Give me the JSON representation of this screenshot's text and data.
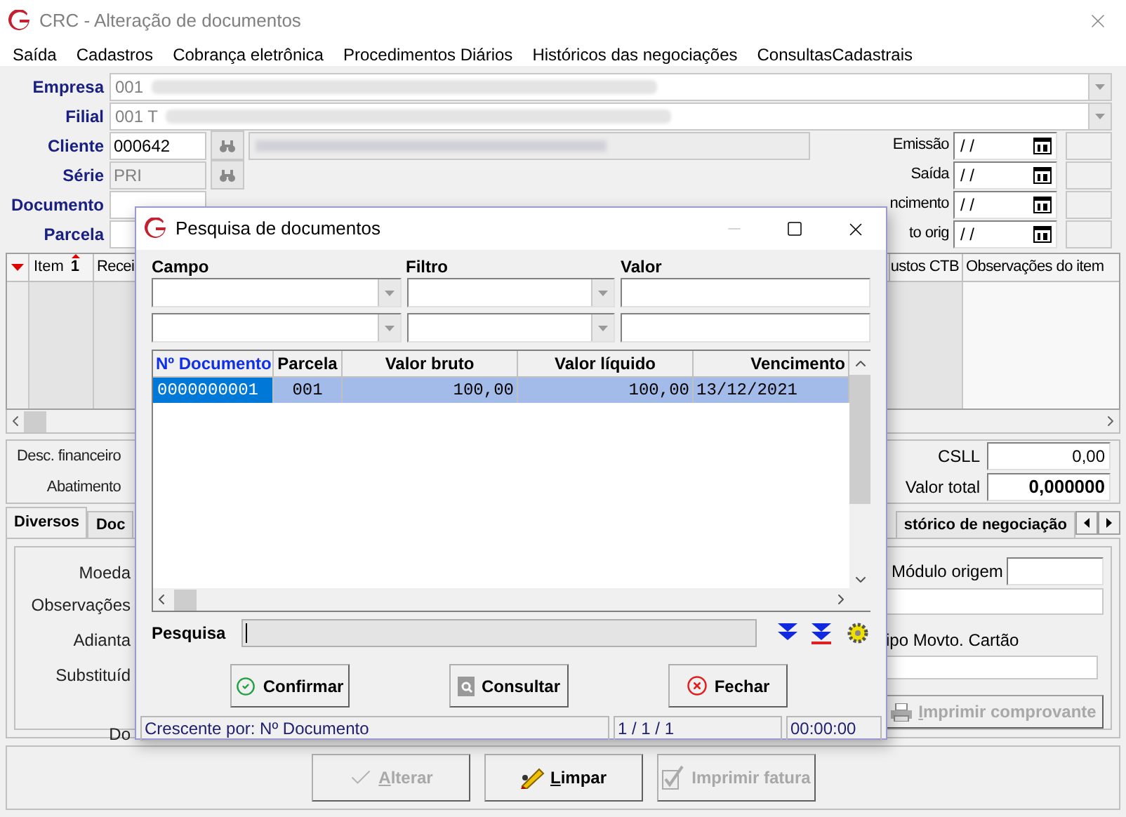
{
  "window": {
    "title": "CRC - Alteração de documentos"
  },
  "menu": [
    "Saída",
    "Cadastros",
    "Cobrança eletrônica",
    "Procedimentos Diários",
    "Históricos das negociações",
    "ConsultasCadastrais"
  ],
  "selectors": [
    {
      "label": "Empresa",
      "value": "001"
    },
    {
      "label": "Filial",
      "value": "001 T"
    }
  ],
  "codes": [
    {
      "label": "Cliente",
      "value": "000642",
      "disabled": false,
      "lookup": true
    },
    {
      "label": "Série",
      "value": "PRI",
      "disabled": true,
      "lookup": true
    },
    {
      "label": "Documento",
      "disabled": false,
      "lookup": false
    },
    {
      "label": "Parcela",
      "disabled": false,
      "lookup": false
    }
  ],
  "dates": [
    {
      "label": "Emissão",
      "value": "/ /"
    },
    {
      "label": "Saída",
      "value": "/ /"
    },
    {
      "label": "ncimento",
      "value": "/ /"
    },
    {
      "label": "to orig",
      "value": "/ /"
    }
  ],
  "items_grid": {
    "columns": [
      "Item",
      "Recei",
      "ustos CTB",
      "Observações do item"
    ],
    "sort_indicator": "1"
  },
  "totals_left": [
    "Desc. financeiro",
    "Abatimento"
  ],
  "totals_right": [
    {
      "label": "CSLL",
      "value": "0,00",
      "bold": false
    },
    {
      "label": "Valor total",
      "value": "0,000000",
      "bold": true
    }
  ],
  "tabs": [
    {
      "label": "Diversos",
      "selected": true
    },
    {
      "label": "Doc",
      "selected": false
    },
    {
      "label": "stórico de negociação",
      "selected": false
    }
  ],
  "tab_panel": {
    "left_labels": [
      "Moeda",
      "Observações",
      "Adianta",
      "Substituíd",
      "Do"
    ],
    "module_label": "Módulo origem",
    "card_type_label": "ipo Movto. Cartão",
    "print_button": {
      "label": "Imprimir comprovante",
      "disabled": true
    }
  },
  "bottom_buttons": [
    {
      "label": "Alterar",
      "disabled": true
    },
    {
      "label": "Limpar",
      "disabled": false
    },
    {
      "label": "Imprimir fatura",
      "disabled": true
    }
  ],
  "dialog": {
    "title": "Pesquisa de documentos",
    "filter_headers": [
      "Campo",
      "Filtro",
      "Valor"
    ],
    "table": {
      "columns": [
        {
          "label": "Nº Documento",
          "sorted": true
        },
        {
          "label": "Parcela",
          "sorted": false
        },
        {
          "label": "Valor bruto",
          "sorted": false
        },
        {
          "label": "Valor líquido",
          "sorted": false
        },
        {
          "label": "Vencimento",
          "sorted": false
        }
      ],
      "rows": [
        {
          "cells": [
            "0000000001",
            "001",
            "100,00",
            "100,00",
            "13/12/2021"
          ],
          "selected": true
        }
      ]
    },
    "search_label": "Pesquisa",
    "buttons": [
      "Confirmar",
      "Consultar",
      "Fechar"
    ],
    "status_bar": [
      "Crescente por: Nº Documento",
      "1 / 1 / 1",
      "00:00:00"
    ]
  }
}
